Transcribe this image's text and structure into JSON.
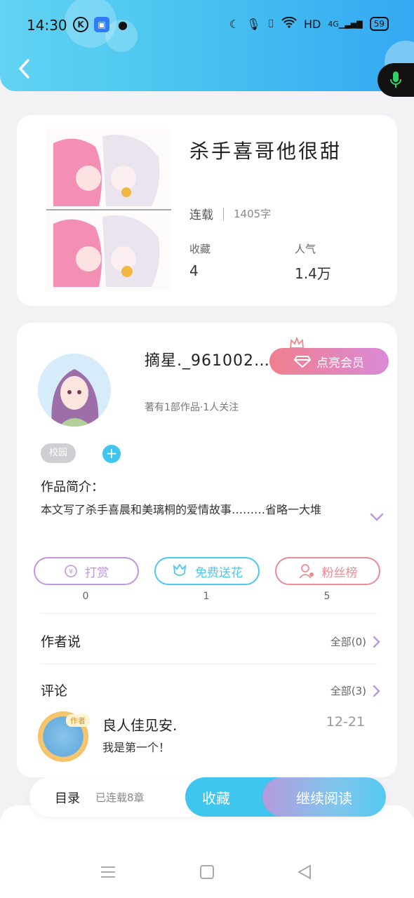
{
  "status_bar": {
    "time": "14:30",
    "network": "HD",
    "cell": "4G",
    "battery": "59"
  },
  "book": {
    "title": "杀手喜哥他很甜",
    "status": "连载",
    "word_count": "1405字",
    "collect_label": "收藏",
    "collect_value": "4",
    "popularity_label": "人气",
    "popularity_value": "1.4万"
  },
  "author": {
    "name": "摘星._961002…",
    "vip_label": "点亮会员",
    "meta": "著有1部作品·1人关注",
    "tag": "校园"
  },
  "intro": {
    "label": "作品简介：",
    "text": "本文写了杀手喜晨和美璃桐的爱情故事………省略一大堆"
  },
  "actions": [
    {
      "label": "打赏",
      "count": "0",
      "color": "#c394e0"
    },
    {
      "label": "免费送花",
      "count": "1",
      "color": "#4cc7ee"
    },
    {
      "label": "粉丝榜",
      "count": "5",
      "color": "#ec8b95"
    }
  ],
  "sections": {
    "author_says": {
      "label": "作者说",
      "all": "全部(0)"
    },
    "comments": {
      "label": "评论",
      "all": "全部(3)"
    }
  },
  "comment": {
    "badge": "作者",
    "name": "良人佳见安.",
    "date": "12-21",
    "text": "我是第一个！"
  },
  "bottom_bar": {
    "toc_label": "目录",
    "toc_count": "已连载8章",
    "favorite": "收藏",
    "continue": "继续阅读"
  },
  "colors": {
    "accent": "#3fc6ee",
    "header_start": "#62d3f2",
    "header_end": "#33a9f2"
  }
}
